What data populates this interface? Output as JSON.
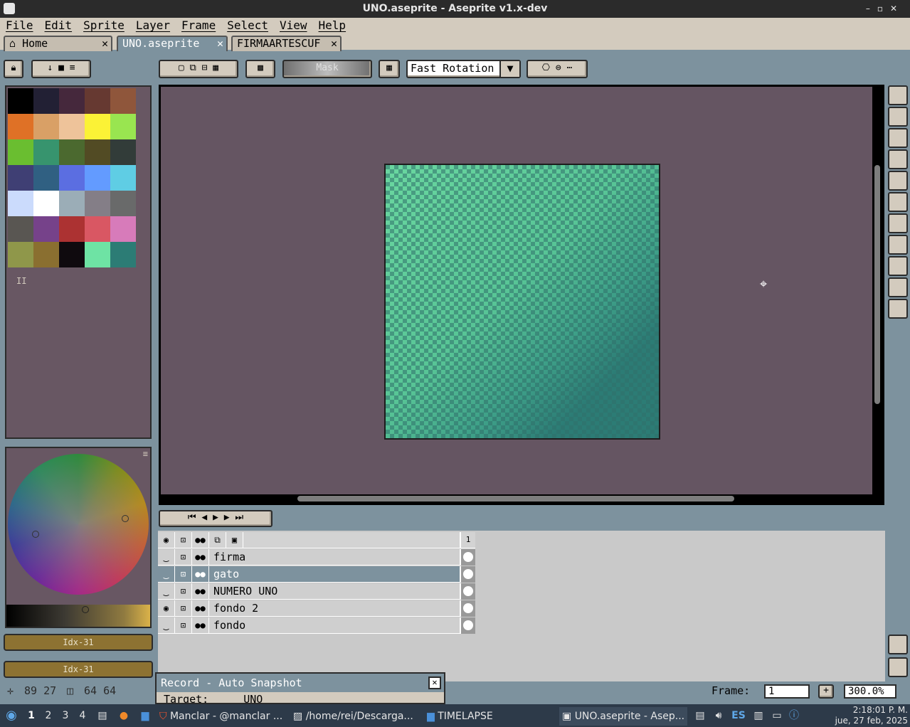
{
  "window": {
    "title": "UNO.aseprite - Aseprite v1.x-dev"
  },
  "menu": [
    "File",
    "Edit",
    "Sprite",
    "Layer",
    "Frame",
    "Select",
    "View",
    "Help"
  ],
  "tabs": [
    {
      "label": "Home",
      "icon": "home-icon"
    },
    {
      "label": "UNO.aseprite",
      "close": "✕"
    },
    {
      "label": "FIRMAARTESCUF",
      "close": "✕"
    }
  ],
  "toolbar": {
    "mask_label": "Mask",
    "rotation_select": "Fast Rotation"
  },
  "palette": {
    "colors": [
      "#000000",
      "#222034",
      "#45283c",
      "#663931",
      "#8f563b",
      "#df7126",
      "#d9a066",
      "#eec39a",
      "#fbf236",
      "#99e550",
      "#6abe30",
      "#37946e",
      "#4b692f",
      "#524b24",
      "#323c39",
      "#3f3f74",
      "#306082",
      "#5b6ee1",
      "#639bff",
      "#5fcde4",
      "#cbdbfc",
      "#ffffff",
      "#9badb7",
      "#847e87",
      "#696a6a",
      "#595652",
      "#76428a",
      "#ac3232",
      "#d95763",
      "#d77bba",
      "#8f974a",
      "#8a6f30",
      "#0f0a0e",
      "#6ee3a4",
      "#2c7c75"
    ],
    "pause_glyph": "II"
  },
  "color_bars": {
    "fg": "Idx-31",
    "bg": "Idx-31"
  },
  "layers": [
    {
      "name": "firma",
      "visible": false
    },
    {
      "name": "gato",
      "visible": false,
      "selected": true
    },
    {
      "name": "NUMERO UNO",
      "visible": false
    },
    {
      "name": "fondo 2",
      "visible": true
    },
    {
      "name": "fondo",
      "visible": false
    }
  ],
  "timeline": {
    "frame_header": "1"
  },
  "record": {
    "title": "Record - Auto Snapshot",
    "target_label": "Target:",
    "target_value": "UNO"
  },
  "status": {
    "cursor": "89 27",
    "size": "64 64",
    "frame_label": "Frame:",
    "frame_value": "1",
    "zoom": "300.0%"
  },
  "taskbar": {
    "workspaces": [
      "1",
      "2",
      "3",
      "4"
    ],
    "apps": [
      {
        "label": "Manclar - @manclar ..."
      },
      {
        "label": "/home/rei/Descarga..."
      },
      {
        "label": "TIMELAPSE"
      },
      {
        "label": "UNO.aseprite - Asep..."
      }
    ],
    "lang": "ES",
    "time": "2:18:01 P. M.",
    "date": "jue, 27 feb, 2025"
  }
}
